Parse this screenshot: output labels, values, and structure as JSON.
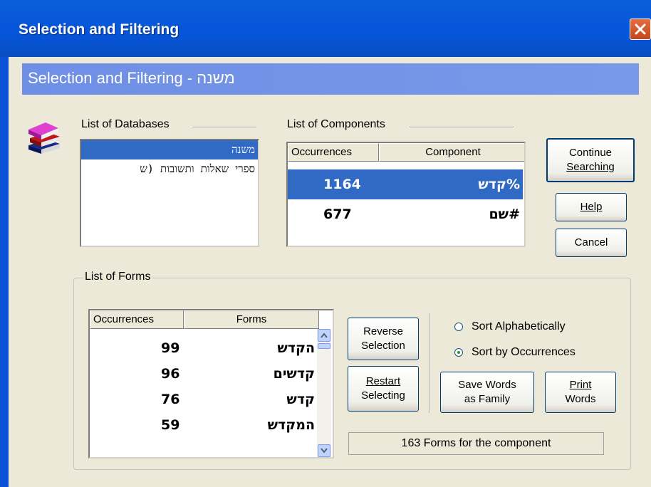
{
  "window": {
    "title": "Selection and Filtering",
    "banner": "Selection and Filtering - משנה"
  },
  "databases": {
    "label": "List of Databases",
    "items": [
      "משנה",
      "ספרי שאלות ותשובות (ש"
    ],
    "selected_index": 0
  },
  "components": {
    "label": "List of Components",
    "columns": [
      "Occurrences",
      "Component"
    ],
    "rows": [
      {
        "count": "1164",
        "word": "%קדש",
        "selected": true
      },
      {
        "count": "677",
        "word": "#שם",
        "selected": false
      }
    ]
  },
  "buttons": {
    "continue_1": "Continue",
    "continue_2": "Searching",
    "help": "Help",
    "cancel": "Cancel",
    "reverse_1": "Reverse",
    "reverse_2": "Selection",
    "restart_1": "Restart",
    "restart_2": "Selecting",
    "save_1": "Save Words",
    "save_2": "as Family",
    "print_1": "Print",
    "print_2": "Words"
  },
  "forms": {
    "label": "List of Forms",
    "columns": [
      "Occurrences",
      "Forms"
    ],
    "rows": [
      {
        "count": "99",
        "word": "הקדש"
      },
      {
        "count": "96",
        "word": "קדשים"
      },
      {
        "count": "76",
        "word": "קדש"
      },
      {
        "count": "59",
        "word": "המקדש"
      }
    ]
  },
  "sort": {
    "alpha": "Sort Alphabetically",
    "occ": "Sort by Occurrences",
    "selected": "occ"
  },
  "status": "163 Forms for the component",
  "colors": {
    "titlebar": "#0554d9",
    "banner": "#7a98e8",
    "selection": "#316ac5",
    "face": "#ece9d8"
  }
}
